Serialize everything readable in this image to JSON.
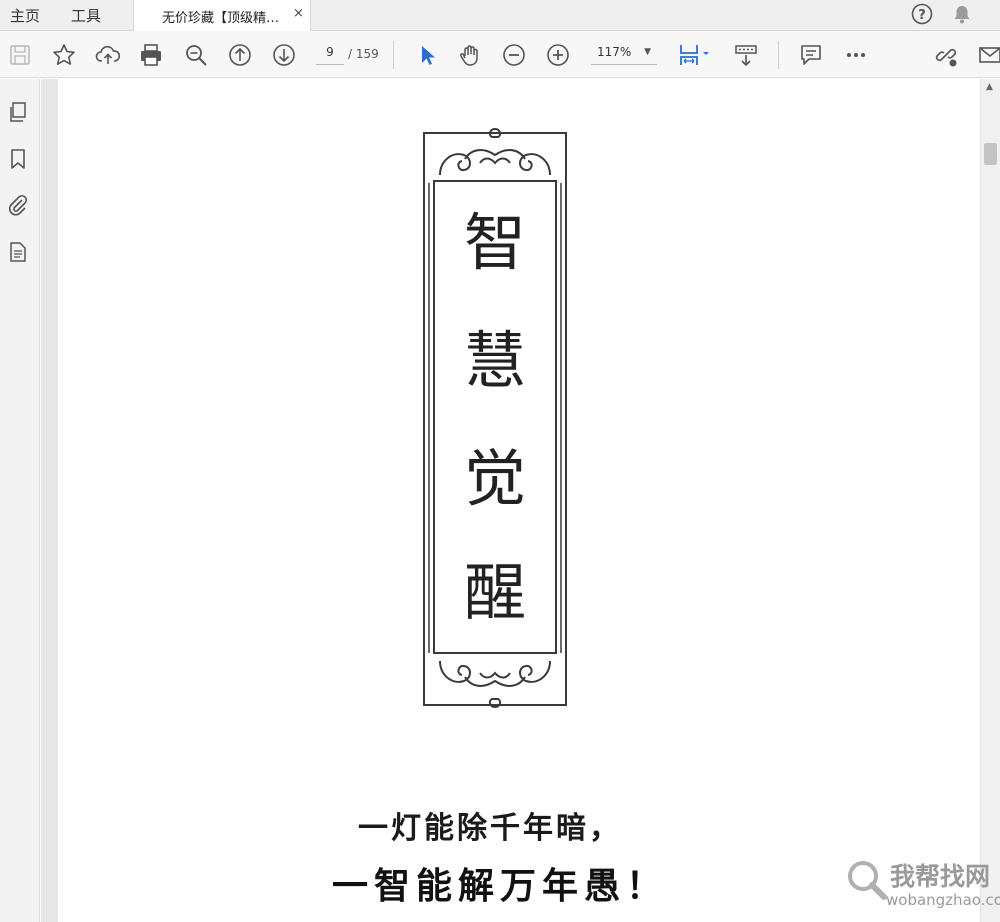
{
  "tabbar": {
    "home": "主页",
    "tools": "工具",
    "doc_tab_title": "无价珍藏【顶级精…",
    "doc_tab_close": "×"
  },
  "toolbar": {
    "page_current": "9",
    "page_total": "/ 159",
    "zoom": "117%"
  },
  "icons": {
    "save": "save-icon",
    "star": "bookmark-star-icon",
    "upload": "cloud-upload-icon",
    "print": "print-icon",
    "zoom_search": "zoom-search-icon",
    "prev": "prev-page-icon",
    "next": "next-page-icon",
    "select": "select-cursor-icon",
    "hand": "hand-tool-icon",
    "zoom_out": "zoom-out-icon",
    "zoom_in": "zoom-in-icon",
    "fit": "fit-page-icon",
    "scroll_mode": "scroll-mode-icon",
    "comment": "comment-icon",
    "more": "more-icon",
    "share": "share-link-icon",
    "email": "email-icon",
    "help": "help-icon",
    "bell": "notification-bell-icon"
  },
  "accent": "#2a6fcb",
  "document": {
    "vertical_title": [
      "智",
      "慧",
      "觉",
      "醒"
    ],
    "line1": "一灯能除千年暗，",
    "line2": "一智能解万年愚！"
  },
  "watermark": {
    "cn": "我帮找网",
    "en": "wobangzhao.com"
  }
}
